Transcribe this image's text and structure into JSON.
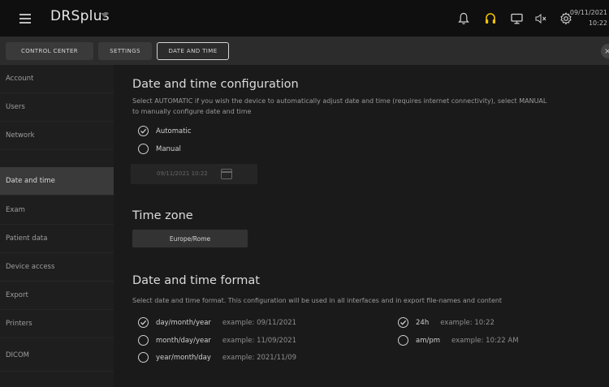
{
  "app": {
    "title": "DRSplus"
  },
  "topbar": {
    "icons": [
      "bell-icon",
      "headset-icon",
      "monitor-icon",
      "volume-muted-icon",
      "gear-icon"
    ],
    "accent_color": "#f5c400",
    "date": "09/11/2021",
    "time": "10:22"
  },
  "tabs": [
    {
      "label": "CONTROL CENTER"
    },
    {
      "label": "SETTINGS"
    },
    {
      "label": "DATE AND TIME",
      "active": true
    }
  ],
  "tab_close": "×",
  "sidebar": {
    "items": [
      {
        "label": "Account"
      },
      {
        "label": "Users"
      },
      {
        "label": "Network"
      },
      {
        "label": "Date and time",
        "active": true
      },
      {
        "label": "Exam"
      },
      {
        "label": "Patient data"
      },
      {
        "label": "Device access"
      },
      {
        "label": "Export"
      },
      {
        "label": "Printers"
      },
      {
        "label": "DICOM"
      }
    ]
  },
  "config": {
    "title": "Date and time configuration",
    "desc_line1": "Select AUTOMATIC if you wish the device to automatically adjust date and time (requires internet connectivity), select MANUAL",
    "desc_line2": "to manually configure date and time",
    "options": [
      {
        "label": "Automatic",
        "selected": true
      },
      {
        "label": "Manual",
        "selected": false
      }
    ],
    "datetime_value": "09/11/2021 10:22"
  },
  "timezone": {
    "title": "Time zone",
    "value": "Europe/Rome"
  },
  "format": {
    "title": "Date and time format",
    "desc": "Select date and time format. This configuration will be used in all interfaces and in export file-names and content",
    "date_options": [
      {
        "label": "day/month/year",
        "example": "example: 09/11/2021",
        "selected": true
      },
      {
        "label": "month/day/year",
        "example": "example: 11/09/2021",
        "selected": false
      },
      {
        "label": "year/month/day",
        "example": "example: 2021/11/09",
        "selected": false
      }
    ],
    "time_options": [
      {
        "label": "24h",
        "example": "example: 10:22",
        "selected": true
      },
      {
        "label": "am/pm",
        "example": "example: 10:22 AM",
        "selected": false
      }
    ]
  }
}
